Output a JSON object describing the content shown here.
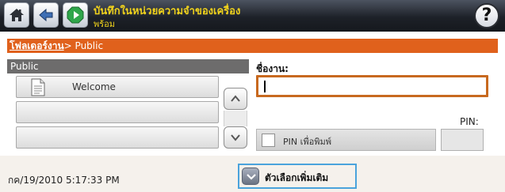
{
  "titlebar": {
    "title": "บันทึกในหน่วยความจำของเครื่อง",
    "subtitle": "พร้อม",
    "help_label": "?"
  },
  "breadcrumb": {
    "link": "โฟลเดอร์งาน",
    "separator": ">",
    "current": "Public"
  },
  "folder_list": {
    "header": "Public",
    "items": [
      {
        "label": "Welcome",
        "icon": "document-icon"
      },
      {
        "label": ""
      },
      {
        "label": ""
      }
    ]
  },
  "job": {
    "name_label": "ชื่องาน:",
    "name_value": ""
  },
  "pin": {
    "label": "PIN:",
    "toggle_label": "PIN เพื่อพิมพ์",
    "checked": false,
    "value": ""
  },
  "footer": {
    "datetime": "กค/19/2010 5:17:33 PM",
    "more_options_label": "ตัวเลือกเพิ่มเติม"
  },
  "colors": {
    "accent_orange": "#e0611c",
    "title_text": "#f0d21c",
    "focus_blue": "#4aa3dc",
    "input_border": "#c8691f"
  }
}
